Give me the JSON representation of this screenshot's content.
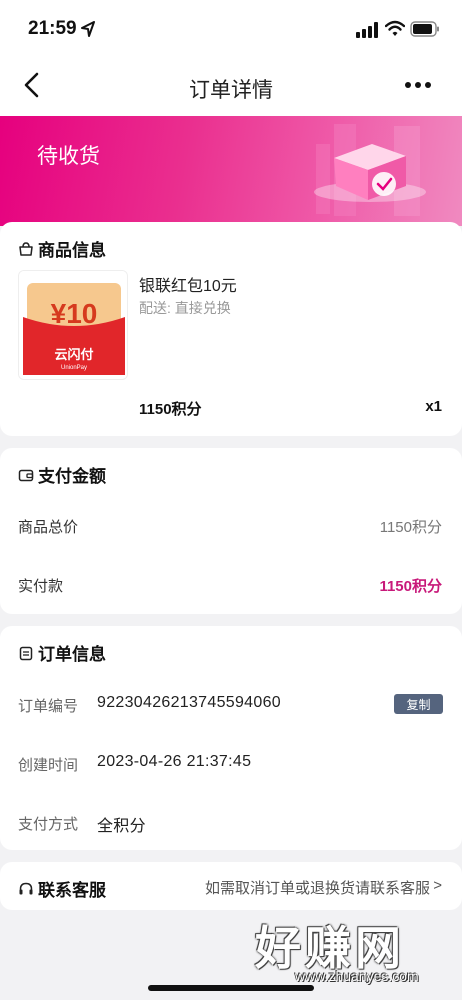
{
  "status_bar": {
    "time": "21:59"
  },
  "nav": {
    "title": "订单详情"
  },
  "banner": {
    "status": "待收货"
  },
  "products": {
    "section_title": "商品信息",
    "item": {
      "name": "银联红包10元",
      "delivery": "配送: 直接兑换",
      "points": "1150积分",
      "quantity": "x1",
      "thumb_amount": "¥10",
      "thumb_brand": "云闪付",
      "thumb_brand_en": "UnionPay"
    }
  },
  "payment": {
    "section_title": "支付金额",
    "total_label": "商品总价",
    "total_value": "1150积分",
    "paid_label": "实付款",
    "paid_value": "1150积分"
  },
  "order": {
    "section_title": "订单信息",
    "number_label": "订单编号",
    "number_value": "92230426213745594060",
    "copy_label": "复制",
    "created_label": "创建时间",
    "created_value": "2023-04-26 21:37:45",
    "pay_method_label": "支付方式",
    "pay_method_value": "全积分"
  },
  "service": {
    "section_title": "联系客服",
    "hint": "如需取消订单或退换货请联系客服",
    "chevron": ">"
  },
  "watermark": {
    "text": "好赚网",
    "url": "www.zhuanyes.com"
  },
  "icons": {
    "location": "location-arrow-icon",
    "signal": "cellular-signal-icon",
    "wifi": "wifi-icon",
    "battery": "battery-icon",
    "back": "back-chevron-icon",
    "more": "more-dots-icon",
    "bag": "shopping-bag-icon",
    "wallet": "wallet-icon",
    "clipboard": "clipboard-icon",
    "headset": "headset-icon"
  },
  "colors": {
    "accent": "#c8197a",
    "banner": "#e6007e",
    "copy_button": "#55647e"
  }
}
